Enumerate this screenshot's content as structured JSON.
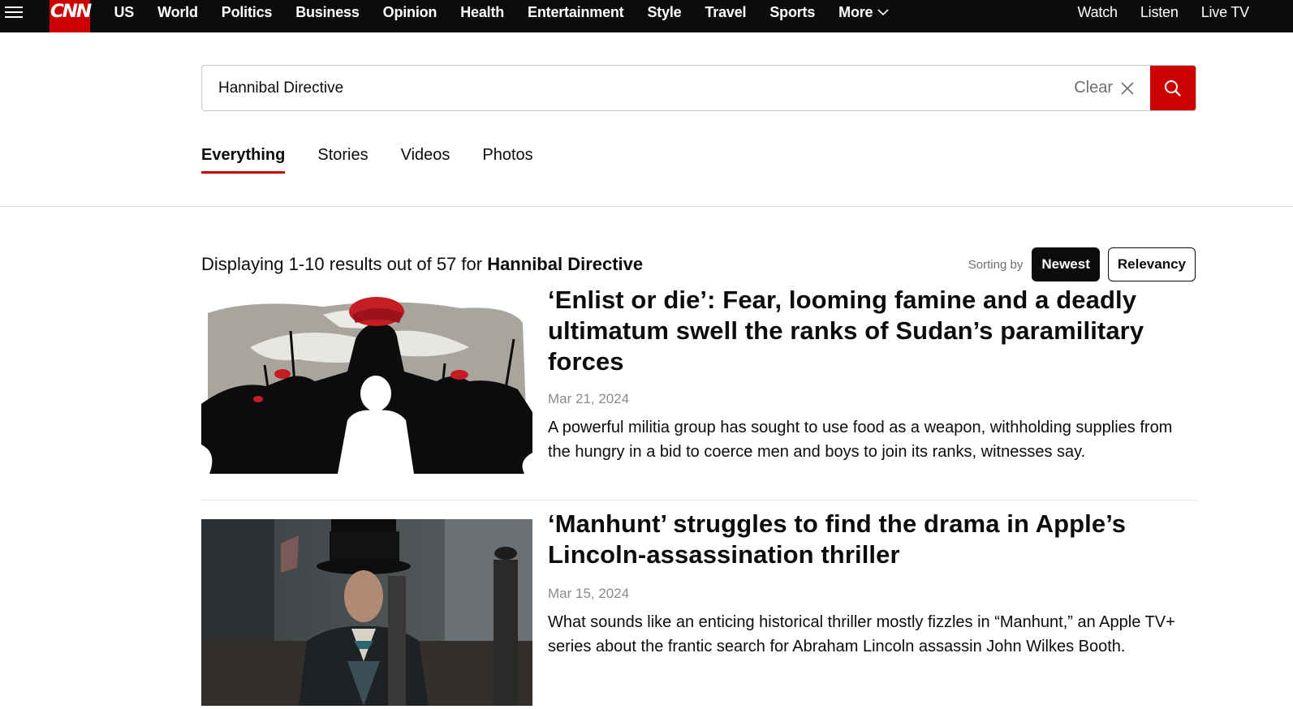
{
  "nav": {
    "logo": "CNN",
    "links": [
      "US",
      "World",
      "Politics",
      "Business",
      "Opinion",
      "Health",
      "Entertainment",
      "Style",
      "Travel",
      "Sports"
    ],
    "more_label": "More",
    "right_links": [
      "Watch",
      "Listen",
      "Live TV"
    ]
  },
  "search": {
    "value": "Hannibal Directive",
    "clear_label": "Clear"
  },
  "tabs": [
    "Everything",
    "Stories",
    "Videos",
    "Photos"
  ],
  "results": {
    "prefix": "Displaying 1-10 results out of 57 for ",
    "query": "Hannibal Directive",
    "sort_label": "Sorting by",
    "sort_newest": "Newest",
    "sort_relevancy": "Relevancy"
  },
  "articles": [
    {
      "title": "‘Enlist or die’: Fear, looming famine and a deadly ultimatum swell the ranks of Sudan’s paramilitary forces",
      "date": "Mar 21, 2024",
      "description": "A powerful militia group has sought to use food as a weapon, withholding supplies from the hungry in a bid to coerce men and boys to join its ranks, witnesses say."
    },
    {
      "title": "‘Manhunt’ struggles to find the drama in Apple’s Lincoln-assassination thriller",
      "date": "Mar 15, 2024",
      "description": "What sounds like an enticing historical thriller mostly fizzles in “Manhunt,” an Apple TV+ series about the frantic search for Abraham Lincoln assassin John Wilkes Booth."
    }
  ],
  "colors": {
    "brand_red": "#cc0000",
    "nav_bg": "#0c0c0c"
  }
}
